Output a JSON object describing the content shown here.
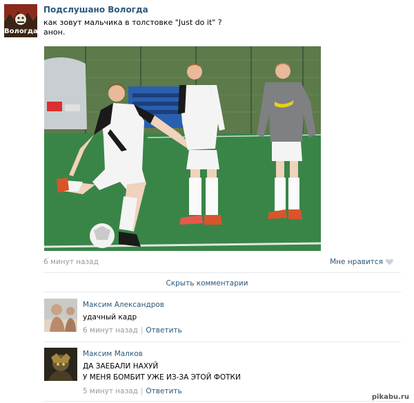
{
  "post": {
    "group_name": "Подслушано Вологда",
    "avatar_label": "Вологда",
    "text_line1": "как зовут мальчика в толстовке \"Just do it\" ?",
    "text_line2": "анон.",
    "time": "6 минут назад",
    "like_label": "Мне нравится",
    "hide_comments": "Скрыть комментарии"
  },
  "comments": [
    {
      "author": "Максим Александров",
      "text_lines": [
        "удачный кадр"
      ],
      "time": "6 минут назад",
      "reply_label": "Ответить"
    },
    {
      "author": "Максим Малков",
      "text_lines": [
        "ДА ЗАЕБАЛИ НАХУЙ",
        "У МЕНЯ БОМБИТ УЖЕ ИЗ-ЗА ЭТОЙ ФОТКИ"
      ],
      "time": "5 минут назад",
      "reply_label": "Ответить"
    }
  ],
  "watermark": "pikabu.ru",
  "colors": {
    "link": "#2b587a",
    "muted": "#999999",
    "separator": "#e4e8ec"
  }
}
